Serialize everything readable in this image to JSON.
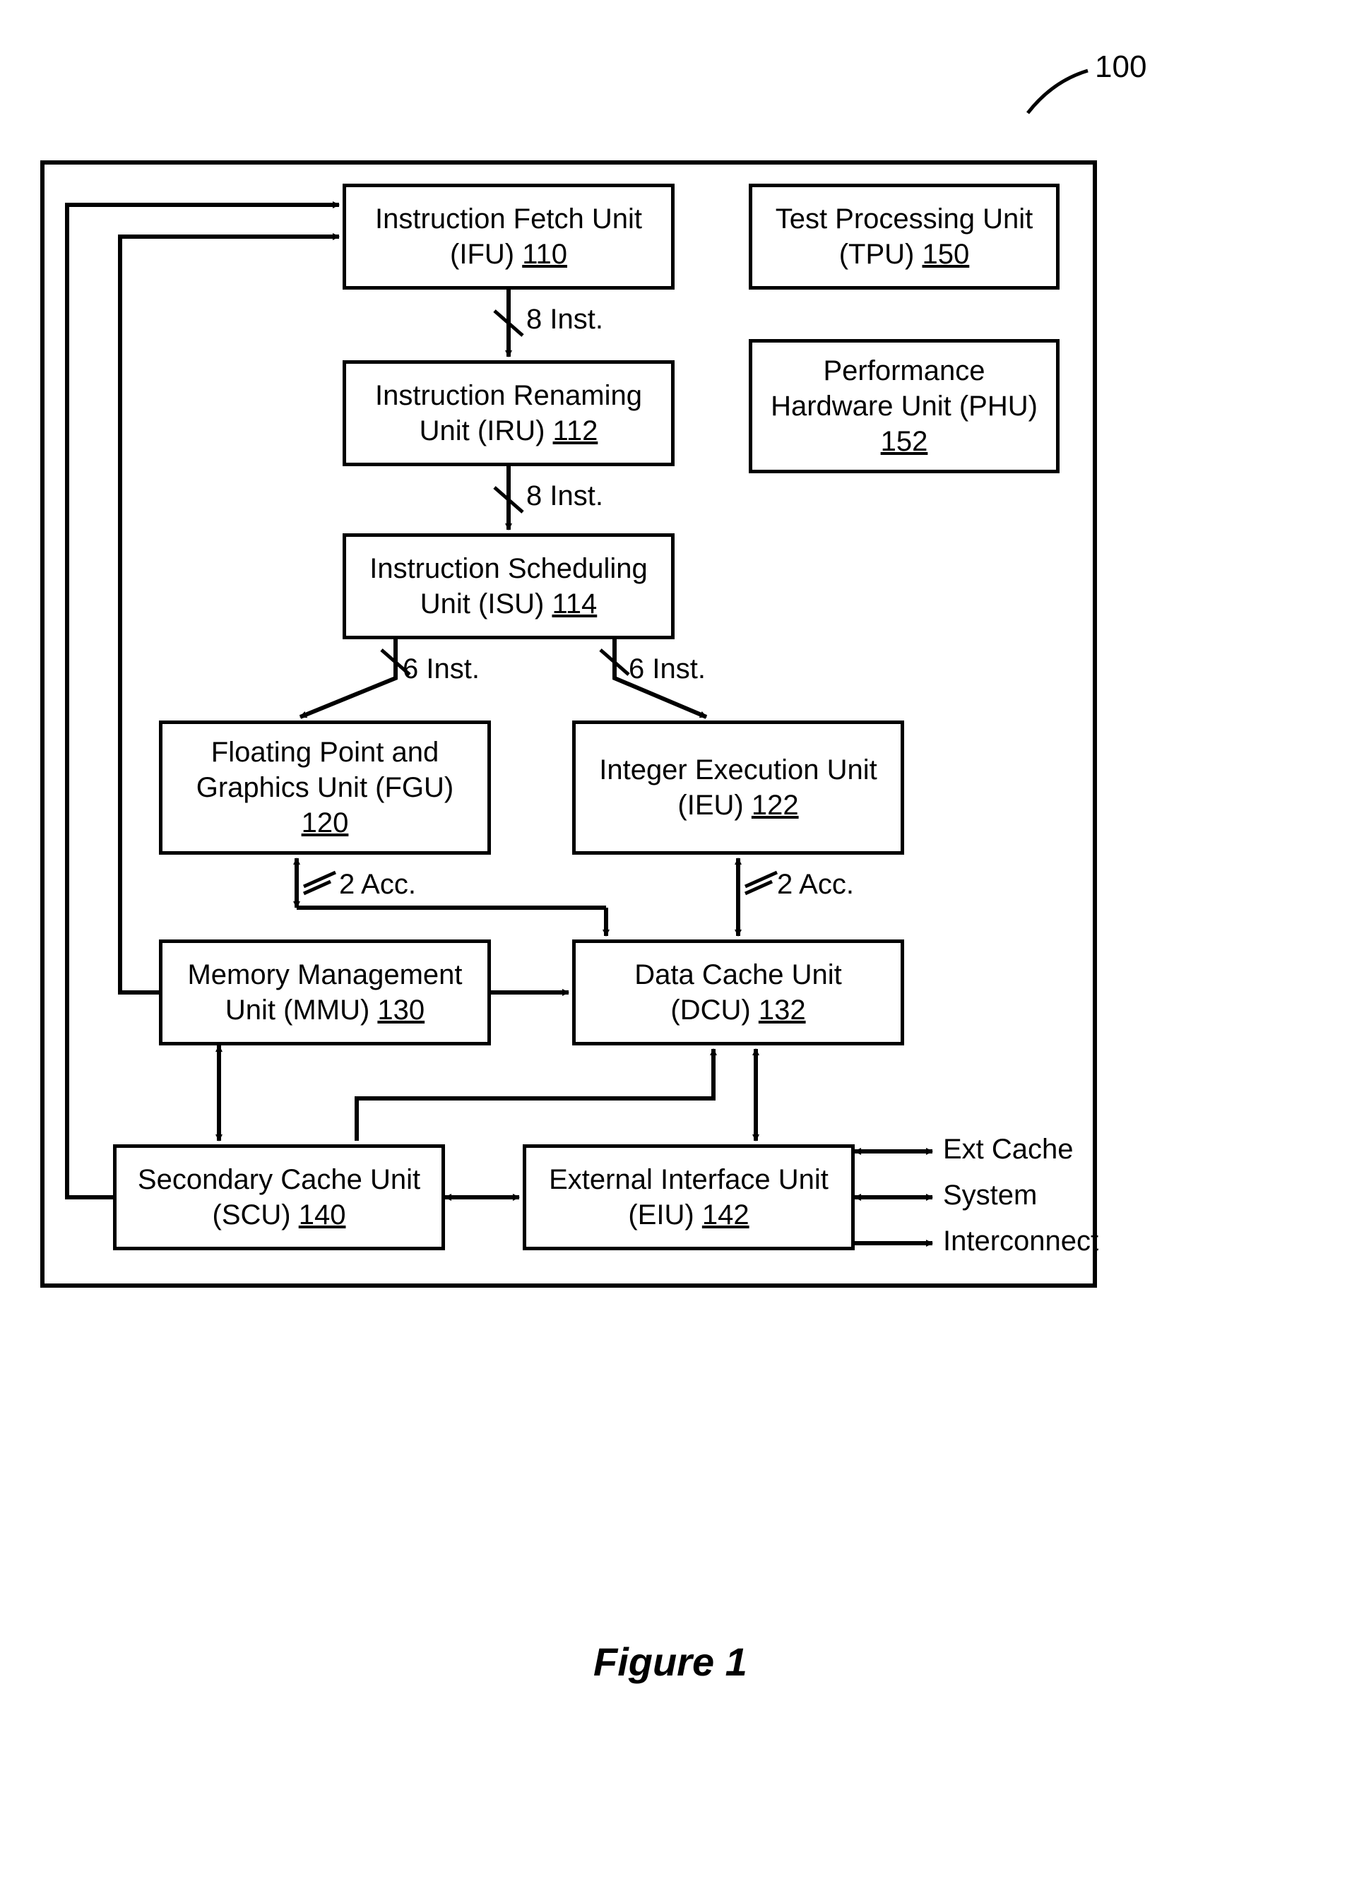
{
  "figure": {
    "ref_label": "100",
    "caption": "Figure 1"
  },
  "boxes": {
    "ifu": {
      "line1": "Instruction Fetch Unit",
      "line2_prefix": "(IFU)  ",
      "ref": "110"
    },
    "tpu": {
      "line1": "Test Processing Unit",
      "line2_prefix": "(TPU)  ",
      "ref": "150"
    },
    "iru": {
      "line1": "Instruction Renaming",
      "line2": "Unit (IRU)  ",
      "ref": "112"
    },
    "phu": {
      "line1": "Performance",
      "line2": "Hardware Unit (PHU)",
      "ref": "152"
    },
    "isu": {
      "line1": "Instruction Scheduling",
      "line2": "Unit (ISU)  ",
      "ref": "114"
    },
    "fgu": {
      "line1": "Floating Point and",
      "line2": "Graphics Unit (FGU)",
      "ref": "120"
    },
    "ieu": {
      "line1": "Integer Execution Unit",
      "line2_prefix": "(IEU)  ",
      "ref": "122"
    },
    "mmu": {
      "line1": "Memory Management",
      "line2": "Unit (MMU)  ",
      "ref": "130"
    },
    "dcu": {
      "line1": "Data Cache Unit",
      "line2_prefix": "(DCU)  ",
      "ref": "132"
    },
    "scu": {
      "line1": "Secondary Cache Unit",
      "line2_prefix": "(SCU)  ",
      "ref": "140"
    },
    "eiu": {
      "line1": "External Interface Unit",
      "line2_prefix": "(EIU)  ",
      "ref": "142"
    }
  },
  "edge_labels": {
    "ifu_iru": "8 Inst.",
    "iru_isu": "8 Inst.",
    "isu_fgu": "6 Inst.",
    "isu_ieu": "6 Inst.",
    "fgu_acc": "2 Acc.",
    "ieu_acc": "2 Acc."
  },
  "ext": {
    "cache": "Ext Cache",
    "system": "System",
    "interconnect": "Interconnect"
  },
  "chart_data": {
    "type": "diagram",
    "title": "Figure 1",
    "figure_ref": "100",
    "nodes": [
      {
        "id": "IFU",
        "label": "Instruction Fetch Unit (IFU)",
        "ref": "110"
      },
      {
        "id": "IRU",
        "label": "Instruction Renaming Unit (IRU)",
        "ref": "112"
      },
      {
        "id": "ISU",
        "label": "Instruction Scheduling Unit (ISU)",
        "ref": "114"
      },
      {
        "id": "FGU",
        "label": "Floating Point and Graphics Unit (FGU)",
        "ref": "120"
      },
      {
        "id": "IEU",
        "label": "Integer Execution Unit (IEU)",
        "ref": "122"
      },
      {
        "id": "MMU",
        "label": "Memory Management Unit (MMU)",
        "ref": "130"
      },
      {
        "id": "DCU",
        "label": "Data Cache Unit (DCU)",
        "ref": "132"
      },
      {
        "id": "SCU",
        "label": "Secondary Cache Unit (SCU)",
        "ref": "140"
      },
      {
        "id": "EIU",
        "label": "External Interface Unit (EIU)",
        "ref": "142"
      },
      {
        "id": "TPU",
        "label": "Test Processing Unit (TPU)",
        "ref": "150"
      },
      {
        "id": "PHU",
        "label": "Performance Hardware Unit (PHU)",
        "ref": "152"
      }
    ],
    "edges": [
      {
        "from": "IFU",
        "to": "IRU",
        "label": "8 Inst.",
        "dir": "forward"
      },
      {
        "from": "IRU",
        "to": "ISU",
        "label": "8 Inst.",
        "dir": "forward"
      },
      {
        "from": "ISU",
        "to": "FGU",
        "label": "6 Inst.",
        "dir": "forward"
      },
      {
        "from": "ISU",
        "to": "IEU",
        "label": "6 Inst.",
        "dir": "forward"
      },
      {
        "from": "DCU",
        "to": "FGU",
        "label": "2 Acc.",
        "dir": "both"
      },
      {
        "from": "DCU",
        "to": "IEU",
        "label": "2 Acc.",
        "dir": "both"
      },
      {
        "from": "MMU",
        "to": "DCU",
        "dir": "forward"
      },
      {
        "from": "MMU",
        "to": "IFU",
        "dir": "forward"
      },
      {
        "from": "MMU",
        "to": "SCU",
        "dir": "both"
      },
      {
        "from": "SCU",
        "to": "IFU",
        "dir": "forward"
      },
      {
        "from": "SCU",
        "to": "EIU",
        "dir": "both"
      },
      {
        "from": "SCU",
        "to": "DCU",
        "dir": "forward"
      },
      {
        "from": "EIU",
        "to": "DCU",
        "dir": "both"
      }
    ],
    "external_ports": [
      {
        "node": "EIU",
        "label": "Ext Cache",
        "dir": "both"
      },
      {
        "node": "EIU",
        "label": "System",
        "dir": "both"
      },
      {
        "node": "EIU",
        "label": "Interconnect",
        "dir": "forward"
      }
    ]
  }
}
